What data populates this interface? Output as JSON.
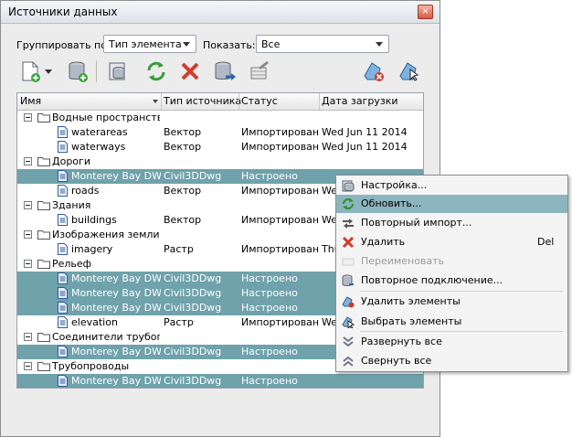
{
  "window": {
    "title": "Источники данных",
    "close_label": "×"
  },
  "toolbar_top": {
    "group_by_label": "Группировать по:",
    "group_by_value": "Тип элемента",
    "show_label": "Показать:",
    "show_value": "Все"
  },
  "columns": [
    "Имя",
    "Тип источника",
    "Статус",
    "Дата загрузки"
  ],
  "rows": [
    {
      "kind": "group",
      "name": "Водные пространства"
    },
    {
      "kind": "item",
      "name": "waterareas",
      "type": "Вектор",
      "status": "Импортировано",
      "date": "Wed Jun 11 2014"
    },
    {
      "kind": "item",
      "name": "waterways",
      "type": "Вектор",
      "status": "Импортировано",
      "date": "Wed Jun 11 2014"
    },
    {
      "kind": "group",
      "name": "Дороги"
    },
    {
      "kind": "item",
      "selected": true,
      "name": "Monterey Bay DW...",
      "type": "Civil3DDwg",
      "status": "Настроено",
      "date": ""
    },
    {
      "kind": "item",
      "name": "roads",
      "type": "Вектор",
      "status": "Импортировано",
      "date": "We"
    },
    {
      "kind": "group",
      "name": "Здания"
    },
    {
      "kind": "item",
      "name": "buildings",
      "type": "Вектор",
      "status": "Импортировано",
      "date": "We"
    },
    {
      "kind": "group",
      "name": "Изображения земли"
    },
    {
      "kind": "item",
      "name": "imagery",
      "type": "Растр",
      "status": "Импортировано",
      "date": "Thu"
    },
    {
      "kind": "group",
      "name": "Рельеф"
    },
    {
      "kind": "item",
      "selected": true,
      "name": "Monterey Bay DW...",
      "type": "Civil3DDwg",
      "status": "Настроено",
      "date": ""
    },
    {
      "kind": "item",
      "selected": true,
      "name": "Monterey Bay DW...",
      "type": "Civil3DDwg",
      "status": "Настроено",
      "date": ""
    },
    {
      "kind": "item",
      "selected": true,
      "name": "Monterey Bay DW...",
      "type": "Civil3DDwg",
      "status": "Настроено",
      "date": ""
    },
    {
      "kind": "item",
      "name": "elevation",
      "type": "Растр",
      "status": "Импортировано",
      "date": "We"
    },
    {
      "kind": "group",
      "name": "Соединители трубоп..."
    },
    {
      "kind": "item",
      "selected": true,
      "name": "Monterey Bay DW...",
      "type": "Civil3DDwg",
      "status": "Настроено",
      "date": ""
    },
    {
      "kind": "group",
      "name": "Трубопроводы"
    },
    {
      "kind": "item",
      "selected": true,
      "name": "Monterey Bay DW...",
      "type": "Civil3DDwg",
      "status": "Настроено",
      "date": ""
    }
  ],
  "context_menu": [
    {
      "label": "Настройка...",
      "icon": "settings-icon"
    },
    {
      "label": "Обновить...",
      "icon": "refresh-icon",
      "highlighted": true
    },
    {
      "label": "Повторный импорт...",
      "icon": "reimport-arrow-icon"
    },
    {
      "label": "Удалить",
      "icon": "delete-x-icon",
      "shortcut": "Del"
    },
    {
      "label": "Переименовать",
      "icon": "rename-icon",
      "disabled": true
    },
    {
      "label": "Повторное подключение...",
      "icon": "reconnect-icon"
    },
    {
      "label": "Удалить элементы",
      "icon": "remove-features-icon"
    },
    {
      "label": "Выбрать элементы",
      "icon": "select-features-icon"
    },
    {
      "label": "Развернуть все",
      "icon": "expand-all-icon"
    },
    {
      "label": "Свернуть все",
      "icon": "collapse-all-icon"
    }
  ]
}
